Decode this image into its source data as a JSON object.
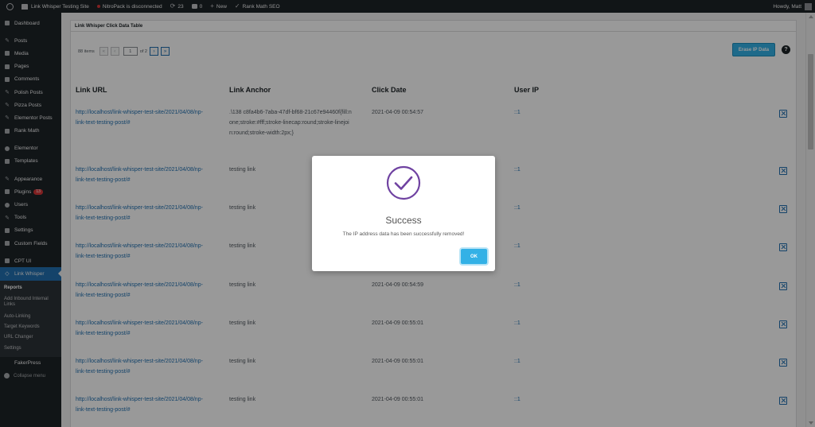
{
  "adminbar": {
    "site_name": "Link Whisper Testing Site",
    "nitropack": "NitroPack is disconnected",
    "updates_count": "23",
    "comments_count": "0",
    "new_label": "New",
    "rankmath_label": "Rank Math SEO",
    "howdy": "Howdy, Matt"
  },
  "sidebar": {
    "items": [
      {
        "label": "Dashboard",
        "icon": "dashboard-icon"
      },
      {
        "label": "Posts",
        "icon": "pin-icon"
      },
      {
        "label": "Media",
        "icon": "media-icon"
      },
      {
        "label": "Pages",
        "icon": "page-icon"
      },
      {
        "label": "Comments",
        "icon": "comment-icon"
      },
      {
        "label": "Polish Posts",
        "icon": "pin-icon"
      },
      {
        "label": "Pizza Posts",
        "icon": "pin-icon"
      },
      {
        "label": "Elementor Posts",
        "icon": "pin-icon"
      },
      {
        "label": "Rank Math",
        "icon": "chart-icon"
      },
      {
        "label": "Elementor",
        "icon": "elementor-icon"
      },
      {
        "label": "Templates",
        "icon": "folder-icon"
      },
      {
        "label": "Appearance",
        "icon": "brush-icon"
      },
      {
        "label": "Plugins",
        "icon": "plugin-icon",
        "badge": "13"
      },
      {
        "label": "Users",
        "icon": "user-icon"
      },
      {
        "label": "Tools",
        "icon": "wrench-icon"
      },
      {
        "label": "Settings",
        "icon": "settings-icon"
      },
      {
        "label": "Custom Fields",
        "icon": "fields-icon"
      },
      {
        "label": "CPT UI",
        "icon": "cpt-icon"
      },
      {
        "label": "Link Whisper",
        "icon": "link-icon"
      }
    ],
    "submenu": [
      "Reports",
      "Add Inbound Internal Links",
      "Auto-Linking",
      "Target Keywords",
      "URL Changer",
      "Settings"
    ],
    "fakerpress": "FakerPress",
    "collapse": "Collapse menu"
  },
  "panel": {
    "title": "Link Whisper Click Data Table",
    "pager": {
      "items": "88 items",
      "first": "«",
      "prev": "‹",
      "current": "1",
      "of": "of 2",
      "next": "›",
      "last": "»"
    },
    "erase_button": "Erase IP Data",
    "help": "?"
  },
  "table": {
    "headers": [
      "Link URL",
      "Link Anchor",
      "Click Date",
      "User IP"
    ],
    "rows": [
      {
        "url": "http://localhost/link-whisper-test-site/2021/04/08/np-link-text-testing-post/#",
        "anchor": ".\\138 c8fa4b6-7aba-47df-bf68-21c67e94460f{fill:none;stroke:#fff;stroke-linecap:round;stroke-linejoin:round;stroke-width:2px;}",
        "date": "2021-04-09 00:54:57",
        "ip": "::1"
      },
      {
        "url": "http://localhost/link-whisper-test-site/2021/04/08/np-link-text-testing-post/#",
        "anchor": "testing link",
        "date": "",
        "ip": "::1"
      },
      {
        "url": "http://localhost/link-whisper-test-site/2021/04/08/np-link-text-testing-post/#",
        "anchor": "testing link",
        "date": "",
        "ip": "::1"
      },
      {
        "url": "http://localhost/link-whisper-test-site/2021/04/08/np-link-text-testing-post/#",
        "anchor": "testing link",
        "date": "",
        "ip": "::1"
      },
      {
        "url": "http://localhost/link-whisper-test-site/2021/04/08/np-link-text-testing-post/#",
        "anchor": "testing link",
        "date": "2021-04-09 00:54:59",
        "ip": "::1"
      },
      {
        "url": "http://localhost/link-whisper-test-site/2021/04/08/np-link-text-testing-post/#",
        "anchor": "testing link",
        "date": "2021-04-09 00:55:01",
        "ip": "::1"
      },
      {
        "url": "http://localhost/link-whisper-test-site/2021/04/08/np-link-text-testing-post/#",
        "anchor": "testing link",
        "date": "2021-04-09 00:55:01",
        "ip": "::1"
      },
      {
        "url": "http://localhost/link-whisper-test-site/2021/04/08/np-link-text-testing-post/#",
        "anchor": "testing link",
        "date": "2021-04-09 00:55:01",
        "ip": "::1"
      }
    ]
  },
  "modal": {
    "title": "Success",
    "message": "The IP address data has been successfully removed!",
    "ok": "OK",
    "accent": "#6f42a1"
  },
  "colors": {
    "admin_dark": "#1d2327",
    "link_blue": "#2271b1",
    "button_blue": "#33b1e6",
    "badge_red": "#d63638"
  }
}
